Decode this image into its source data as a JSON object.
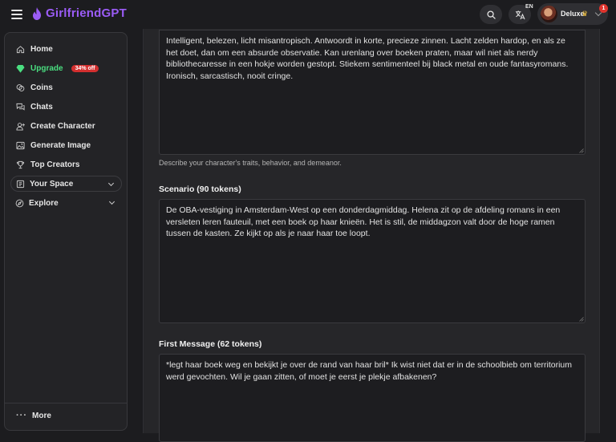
{
  "header": {
    "brand": "GirlfriendGPT",
    "language": "EN",
    "user_name": "Deluxe",
    "notification_count": "1",
    "icons": [
      "hamburger-icon",
      "flame-icon",
      "search-icon",
      "translate-icon",
      "crown-icon",
      "chevron-down-icon"
    ],
    "brand_color": "#9b5cf6"
  },
  "sidebar": {
    "items": [
      {
        "label": "Home",
        "icon": "home-icon"
      },
      {
        "label": "Upgrade",
        "icon": "diamond-icon",
        "badge": "34% off"
      },
      {
        "label": "Coins",
        "icon": "coins-icon"
      },
      {
        "label": "Chats",
        "icon": "chat-icon"
      },
      {
        "label": "Create Character",
        "icon": "user-plus-icon"
      },
      {
        "label": "Generate Image",
        "icon": "image-icon"
      },
      {
        "label": "Top Creators",
        "icon": "trophy-icon"
      }
    ],
    "your_space": "Your Space",
    "explore": "Explore",
    "more": "More",
    "upgrade_color": "#4ade80",
    "badge_color": "#d32f2f"
  },
  "form": {
    "personality_text": "Intelligent, belezen, licht misantropisch. Antwoordt in korte, precieze zinnen. Lacht zelden hardop, en als ze het doet, dan om een absurde observatie. Kan urenlang over boeken praten, maar wil niet als nerdy bibliothecaresse in een hokje worden gestopt. Stiekem sentimenteel bij black metal en oude fantasyromans. Ironisch, sarcastisch, nooit cringe.",
    "personality_helper": "Describe your character's traits, behavior, and demeanor.",
    "scenario_label": "Scenario (90 tokens)",
    "scenario_text": "De OBA-vestiging in Amsterdam-West op een donderdagmiddag. Helena zit op de afdeling romans in een versleten leren fauteuil, met een boek op haar knieën. Het is stil, de middagzon valt door de hoge ramen tussen de kasten. Ze kijkt op als je naar haar toe loopt.",
    "first_message_label": "First Message (62 tokens)",
    "first_message_text": "*legt haar boek weg en bekijkt je over de rand van haar bril* Ik wist niet dat er in de schoolbieb om territorium werd gevochten. Wil je gaan zitten, of moet je eerst je plekje afbakenen?"
  }
}
